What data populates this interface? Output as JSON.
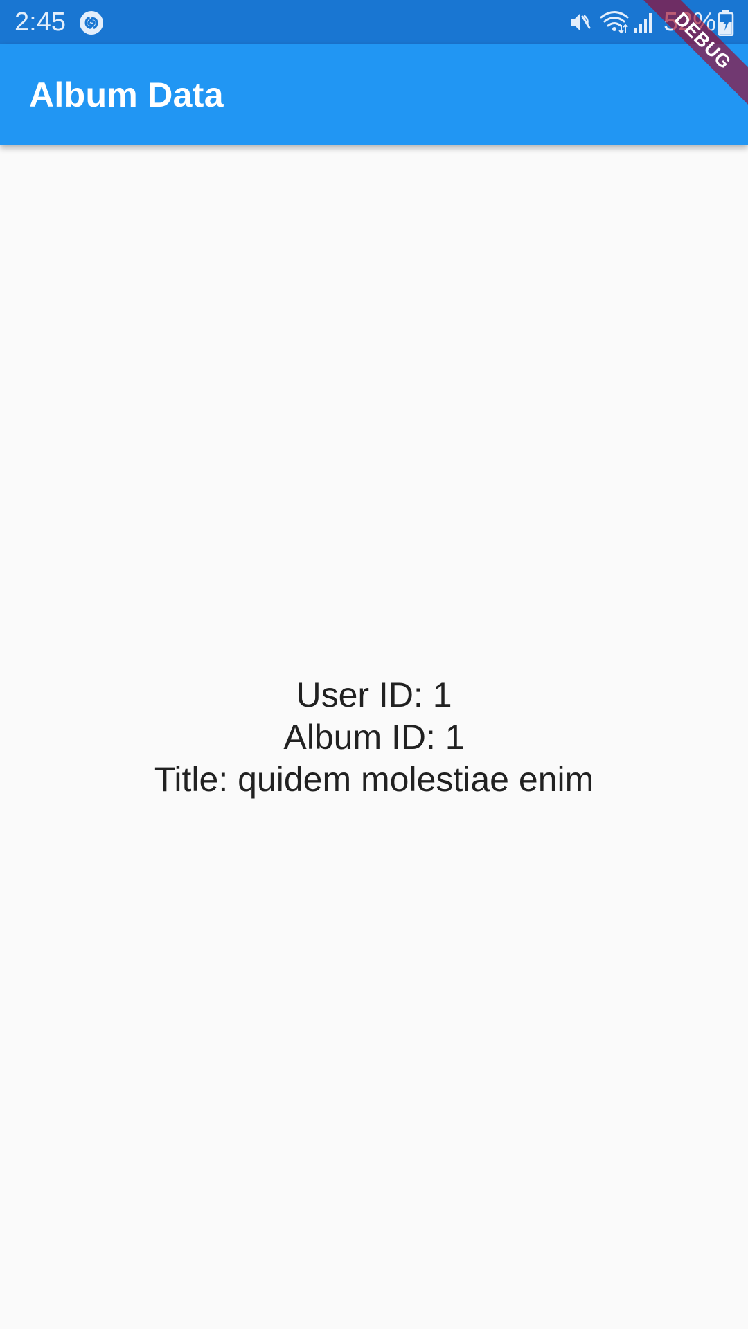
{
  "status_bar": {
    "time": "2:45",
    "battery": "52%",
    "background": "#1976d2",
    "icons": [
      "shazam-icon",
      "mute-icon",
      "wifi-icon",
      "signal-icon",
      "battery-charging-icon"
    ]
  },
  "app_bar": {
    "title": "Album Data",
    "background": "#2196f3"
  },
  "debug_banner": {
    "label": "DEBUG"
  },
  "album": {
    "user_id_line": "User ID: 1",
    "album_id_line": "Album ID: 1",
    "title_line": "Title: quidem molestiae enim"
  }
}
